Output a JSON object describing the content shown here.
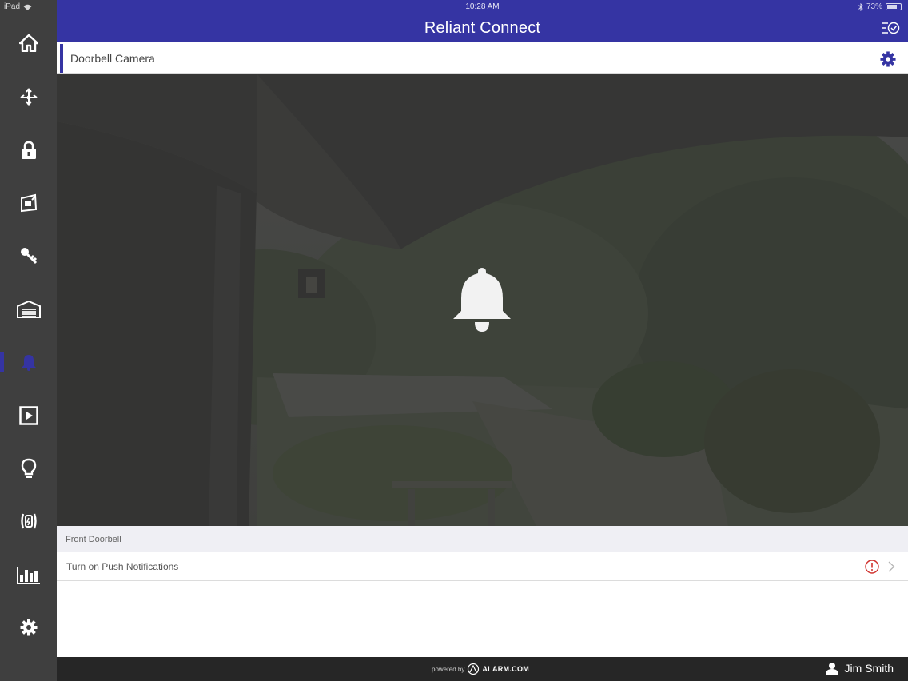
{
  "status_bar": {
    "device": "iPad",
    "time": "10:28 AM",
    "battery": "73%"
  },
  "header": {
    "title": "Reliant Connect",
    "history_icon": "history-list-icon"
  },
  "sidebar": {
    "items": [
      {
        "name": "home",
        "icon": "home-icon"
      },
      {
        "name": "security",
        "icon": "security-arrows-icon"
      },
      {
        "name": "locks",
        "icon": "lock-icon"
      },
      {
        "name": "thermostat",
        "icon": "thermostat-icon"
      },
      {
        "name": "access",
        "icon": "key-icon"
      },
      {
        "name": "garage",
        "icon": "garage-icon"
      },
      {
        "name": "doorbell",
        "icon": "bell-icon",
        "active": true
      },
      {
        "name": "video",
        "icon": "video-play-icon"
      },
      {
        "name": "lights",
        "icon": "lightbulb-icon"
      },
      {
        "name": "energy",
        "icon": "energy-icon"
      },
      {
        "name": "reports",
        "icon": "bar-chart-icon"
      },
      {
        "name": "settings",
        "icon": "gear-icon"
      }
    ]
  },
  "page": {
    "title": "Doorbell Camera"
  },
  "doorbell_list": {
    "section_label": "Front Doorbell",
    "rows": [
      {
        "label": "Turn on Push Notifications",
        "status_icon": "alert-circle-icon"
      }
    ]
  },
  "footer": {
    "powered_by": "powered by",
    "brand": "ALARM.COM",
    "user_name": "Jim Smith"
  },
  "colors": {
    "brand_primary": "#3534a3",
    "sidebar_bg": "#3f3f3f",
    "footer_bg": "#262626",
    "alert_red": "#d0312d"
  }
}
